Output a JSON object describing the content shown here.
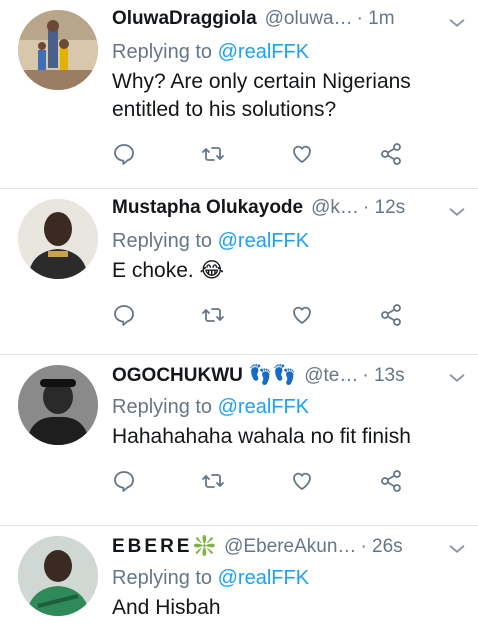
{
  "tweets": [
    {
      "name": "OluwaDraggiola",
      "handle": "@oluwa…",
      "time": "· 1m",
      "reply_prefix": "Replying to ",
      "reply_to": "@realFFK",
      "text": "Why? Are only certain Nigerians entitled to his solutions?"
    },
    {
      "name": "Mustapha Olukayode",
      "handle": "@k…",
      "time": "· 12s",
      "reply_prefix": "Replying to ",
      "reply_to": "@realFFK",
      "text": "E choke. 😂"
    },
    {
      "name": "OGOCHUKWU",
      "name_emoji": "👣👣",
      "handle": "@te…",
      "time": "· 13s",
      "reply_prefix": "Replying to ",
      "reply_to": "@realFFK",
      "text": "Hahahahaha wahala no fit finish"
    },
    {
      "name": "EBERE",
      "name_emoji": "❇️",
      "handle": "@EbereAkun…",
      "time": "· 26s",
      "reply_prefix": "Replying to ",
      "reply_to": "@realFFK",
      "text": "And Hisbah"
    }
  ],
  "icons": {
    "reply": "reply-icon",
    "retweet": "retweet-icon",
    "like": "like-icon",
    "share": "share-icon",
    "more": "chevron-down-icon"
  },
  "colors": {
    "mention": "#1da1f2",
    "secondary": "#657786",
    "divider": "#e1e8ed"
  }
}
